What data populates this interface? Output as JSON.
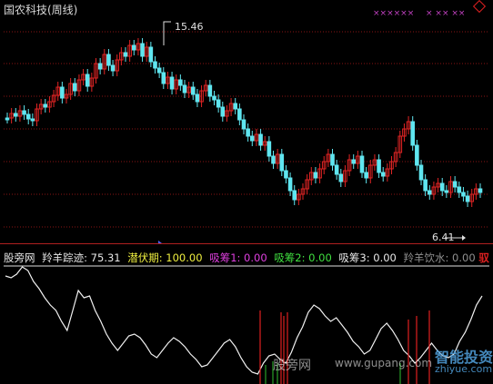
{
  "window": {
    "title": "国农科技(周线)"
  },
  "price_panel": {
    "high_label": "15.46",
    "low_label": "6.41",
    "colors": {
      "up": "#e02424",
      "down": "#5fe6f0",
      "grid": "#8a1414"
    }
  },
  "indicator_bar": {
    "name": "股旁网",
    "items": [
      {
        "label": "羚羊踪迹",
        "value": "75.31",
        "color": "#e8e8e8"
      },
      {
        "label": "潜伏期",
        "value": "100.00",
        "color": "#f0f040"
      },
      {
        "label": "吸筹1",
        "value": "0.00",
        "color": "#e040e0"
      },
      {
        "label": "吸筹2",
        "value": "0.00",
        "color": "#40e040"
      },
      {
        "label": "吸筹3",
        "value": "0.00",
        "color": "#e8e8e8"
      },
      {
        "label": "羚羊饮水",
        "value": "0.00",
        "color": "#909090"
      }
    ],
    "tail_char": "驭"
  },
  "watermark": {
    "left_text": "股旁网",
    "site_text": "www.gupang.com",
    "brand_text": "智能投资",
    "brand_site": "zhiyue.com"
  }
}
